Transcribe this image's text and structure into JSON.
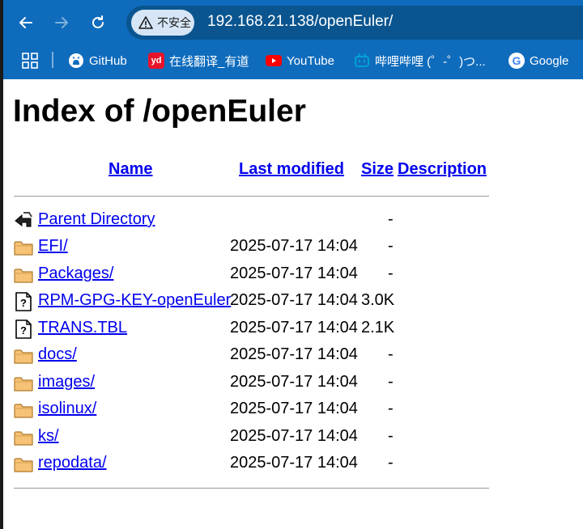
{
  "browser": {
    "security_label": "不安全",
    "url": "192.168.21.138/openEuler/",
    "bookmarks": [
      {
        "label": "GitHub",
        "icon": "github-icon",
        "color": "#ffffff"
      },
      {
        "label": "在线翻译_有道",
        "icon": "youdao-icon",
        "color": "#e8132b"
      },
      {
        "label": "YouTube",
        "icon": "youtube-icon",
        "color": "#ff0000"
      },
      {
        "label": "哔哩哔哩 (゜-゜)つ...",
        "icon": "bilibili-icon",
        "color": "#00a1d6"
      },
      {
        "label": "Google",
        "icon": "google-icon",
        "color": "#4285f4"
      }
    ]
  },
  "page": {
    "title": "Index of /openEuler",
    "headers": {
      "name": "Name",
      "last_modified": "Last modified",
      "size": "Size",
      "description": "Description"
    },
    "parent": {
      "name": "Parent Directory",
      "size": "-"
    },
    "entries": [
      {
        "name": "EFI/",
        "modified": "2025-07-17 14:04",
        "size": "-",
        "type": "folder-icon"
      },
      {
        "name": "Packages/",
        "modified": "2025-07-17 14:04",
        "size": "-",
        "type": "folder-icon"
      },
      {
        "name": "RPM-GPG-KEY-openEuler",
        "modified": "2025-07-17 14:04",
        "size": "3.0K",
        "type": "unknown-file-icon"
      },
      {
        "name": "TRANS.TBL",
        "modified": "2025-07-17 14:04",
        "size": "2.1K",
        "type": "unknown-file-icon"
      },
      {
        "name": "docs/",
        "modified": "2025-07-17 14:04",
        "size": "-",
        "type": "folder-icon"
      },
      {
        "name": "images/",
        "modified": "2025-07-17 14:04",
        "size": "-",
        "type": "folder-icon"
      },
      {
        "name": "isolinux/",
        "modified": "2025-07-17 14:04",
        "size": "-",
        "type": "folder-icon"
      },
      {
        "name": "ks/",
        "modified": "2025-07-17 14:04",
        "size": "-",
        "type": "folder-icon"
      },
      {
        "name": "repodata/",
        "modified": "2025-07-17 14:04",
        "size": "-",
        "type": "folder-icon"
      }
    ]
  }
}
